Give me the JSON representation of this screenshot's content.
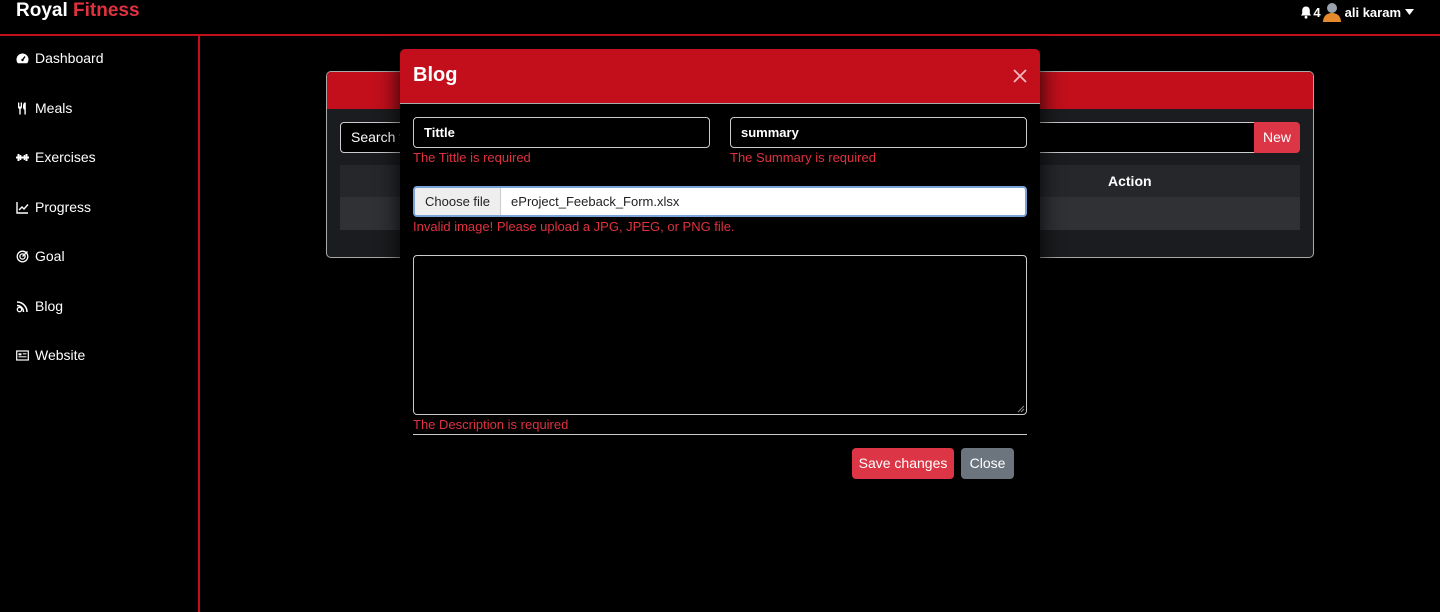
{
  "brand": {
    "part1": "Royal",
    "part2": "Fitness"
  },
  "header": {
    "notification_count": "4",
    "user_name": "ali karam"
  },
  "sidebar": {
    "items": [
      {
        "label": "Dashboard",
        "icon": "gauge-icon"
      },
      {
        "label": "Meals",
        "icon": "utensils-icon"
      },
      {
        "label": "Exercises",
        "icon": "dumbbell-icon"
      },
      {
        "label": "Progress",
        "icon": "chart-line-icon"
      },
      {
        "label": "Goal",
        "icon": "target-icon"
      },
      {
        "label": "Blog",
        "icon": "blog-icon"
      },
      {
        "label": "Website",
        "icon": "web-icon"
      }
    ]
  },
  "background_card": {
    "search_visible_text": "Search f",
    "new_button": "New",
    "action_header": "Action"
  },
  "modal": {
    "title": "Blog",
    "title_value": "Tittle",
    "title_error": "The Tittle is required",
    "summary_value": "summary",
    "summary_error": "The Summary is required",
    "file_button": "Choose file",
    "file_name": "eProject_Feeback_Form.xlsx",
    "file_error": "Invalid image! Please upload a JPG, JPEG, or PNG file.",
    "description_value": "",
    "description_error": "The Description is required",
    "save_button": "Save changes",
    "close_button": "Close"
  },
  "colors": {
    "accent": "#c30f1c",
    "danger": "#dc3545",
    "secondary": "#6c757d",
    "background": "#000000"
  }
}
